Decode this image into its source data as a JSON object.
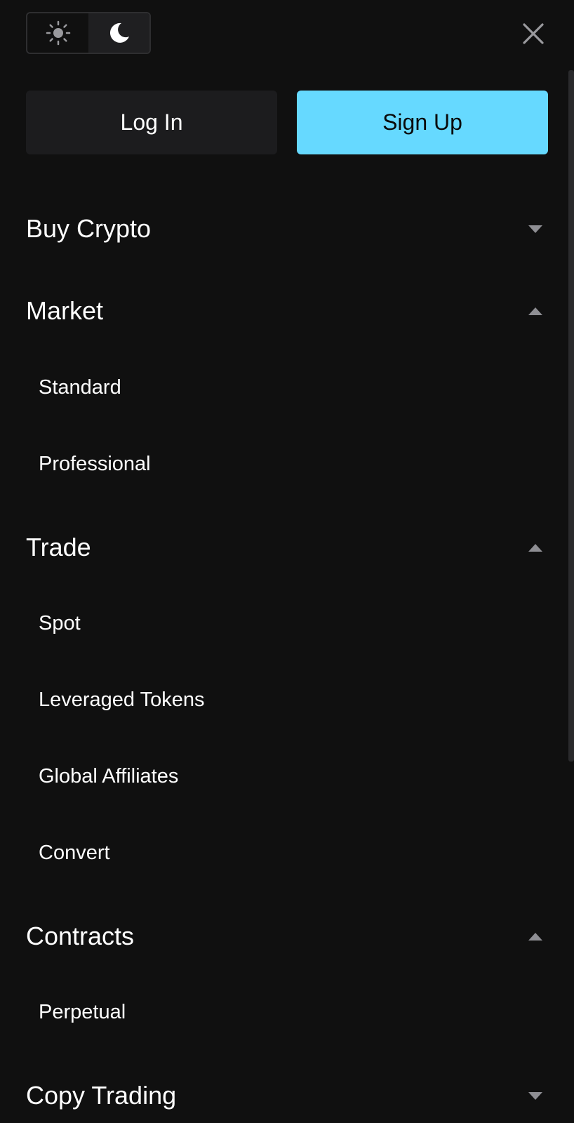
{
  "theme_toggle": {
    "light_icon": "sun-icon",
    "dark_icon": "moon-icon",
    "active": "dark"
  },
  "close_icon": "close-icon",
  "auth": {
    "login_label": "Log In",
    "signup_label": "Sign Up"
  },
  "colors": {
    "background": "#101010",
    "signup": "#66d9ff",
    "login": "#1c1c1e"
  },
  "menu": {
    "buy_crypto": {
      "label": "Buy Crypto",
      "expanded": false
    },
    "market": {
      "label": "Market",
      "expanded": true,
      "items": [
        "Standard",
        "Professional"
      ]
    },
    "trade": {
      "label": "Trade",
      "expanded": true,
      "items": [
        "Spot",
        "Leveraged Tokens",
        "Global Affiliates",
        "Convert"
      ]
    },
    "contracts": {
      "label": "Contracts",
      "expanded": true,
      "items": [
        "Perpetual"
      ]
    },
    "copy_trading": {
      "label": "Copy Trading",
      "expanded": false
    }
  }
}
